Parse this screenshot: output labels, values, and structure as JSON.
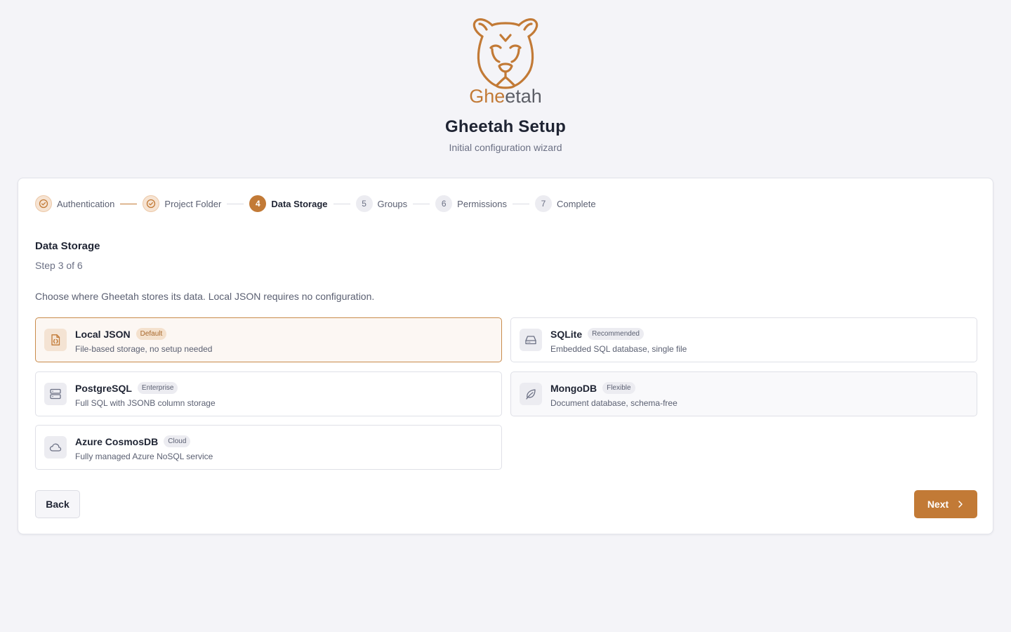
{
  "header": {
    "logo_text": "Gheetah",
    "title": "Gheetah Setup",
    "subtitle": "Initial configuration wizard"
  },
  "stepper": {
    "steps": [
      {
        "label": "Authentication",
        "state": "done",
        "number": "",
        "icon": "check-circle-icon"
      },
      {
        "label": "Project Folder",
        "state": "done",
        "number": "",
        "icon": "check-circle-icon"
      },
      {
        "label": "Data Storage",
        "state": "active",
        "number": "4"
      },
      {
        "label": "Groups",
        "state": "pending",
        "number": "5"
      },
      {
        "label": "Permissions",
        "state": "pending",
        "number": "6"
      },
      {
        "label": "Complete",
        "state": "pending",
        "number": "7"
      }
    ]
  },
  "section": {
    "title": "Data Storage",
    "step_text": "Step 3 of 6",
    "description": "Choose where Gheetah stores its data. Local JSON requires no configuration."
  },
  "options": [
    {
      "name": "Local JSON",
      "badge": "Default",
      "description": "File-based storage, no setup needed",
      "icon": "file-json-icon",
      "selected": true
    },
    {
      "name": "SQLite",
      "badge": "Recommended",
      "description": "Embedded SQL database, single file",
      "icon": "hard-drive-icon",
      "selected": false
    },
    {
      "name": "PostgreSQL",
      "badge": "Enterprise",
      "description": "Full SQL with JSONB column storage",
      "icon": "server-icon",
      "selected": false
    },
    {
      "name": "MongoDB",
      "badge": "Flexible",
      "description": "Document database, schema-free",
      "icon": "leaf-icon",
      "selected": false
    },
    {
      "name": "Azure CosmosDB",
      "badge": "Cloud",
      "description": "Fully managed Azure NoSQL service",
      "icon": "cloud-icon",
      "selected": false
    }
  ],
  "buttons": {
    "back": "Back",
    "next": "Next"
  },
  "colors": {
    "accent": "#c27a36",
    "background": "#f4f4f8"
  }
}
